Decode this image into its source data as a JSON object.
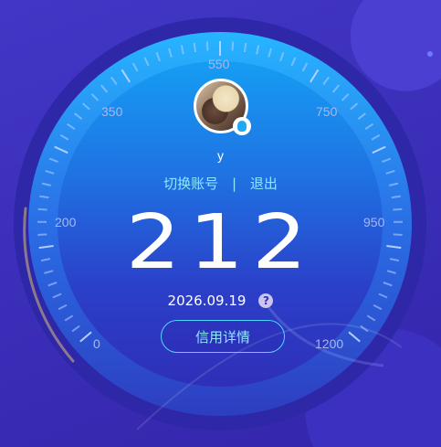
{
  "user": {
    "name": "y",
    "switch_account": "切换账号",
    "separator": "|",
    "logout": "退出"
  },
  "score": {
    "value": "212",
    "date": "2026.09.19",
    "help": "?",
    "detail_button": "信用详情"
  },
  "dial": {
    "labels": [
      "0",
      "200",
      "350",
      "550",
      "750",
      "950",
      "1200"
    ]
  },
  "colors": {
    "background": "#3a2fb8",
    "accent": "#8fe8ff",
    "dial_inner": "#1c8ef0"
  }
}
